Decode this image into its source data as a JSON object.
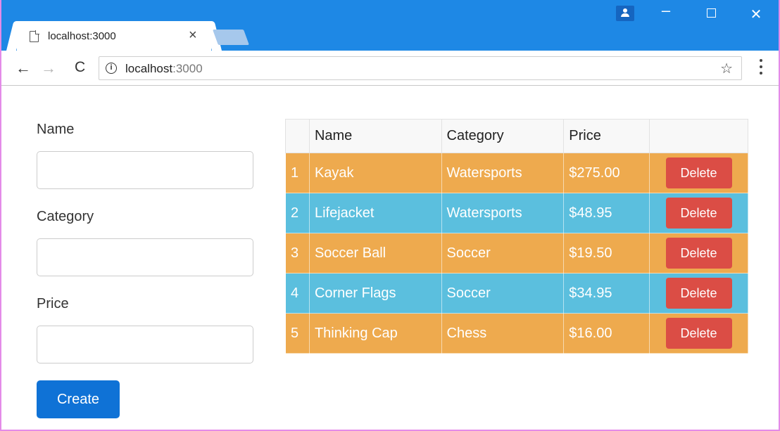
{
  "browser": {
    "tab_title": "localhost:3000",
    "tab_close": "×",
    "url_host": "localhost",
    "url_port": ":3000",
    "back_icon": "←",
    "forward_icon": "→",
    "reload_icon": "C",
    "info_icon": "i",
    "star_icon": "☆",
    "win_min": "–",
    "win_close": "✕"
  },
  "form": {
    "name_label": "Name",
    "name_value": "",
    "category_label": "Category",
    "category_value": "",
    "price_label": "Price",
    "price_value": "",
    "create_label": "Create"
  },
  "table": {
    "headers": [
      "",
      "Name",
      "Category",
      "Price",
      ""
    ],
    "delete_label": "Delete",
    "rows": [
      {
        "index": "1",
        "name": "Kayak",
        "category": "Watersports",
        "price": "$275.00",
        "style": "warning"
      },
      {
        "index": "2",
        "name": "Lifejacket",
        "category": "Watersports",
        "price": "$48.95",
        "style": "info"
      },
      {
        "index": "3",
        "name": "Soccer Ball",
        "category": "Soccer",
        "price": "$19.50",
        "style": "warning"
      },
      {
        "index": "4",
        "name": "Corner Flags",
        "category": "Soccer",
        "price": "$34.95",
        "style": "info"
      },
      {
        "index": "5",
        "name": "Thinking Cap",
        "category": "Chess",
        "price": "$16.00",
        "style": "warning"
      }
    ]
  },
  "colors": {
    "warning_row": "#eeaa4e",
    "info_row": "#5bbfde",
    "delete_button": "#db4d45",
    "create_button": "#0f72d6",
    "titlebar": "#1e88e5"
  }
}
